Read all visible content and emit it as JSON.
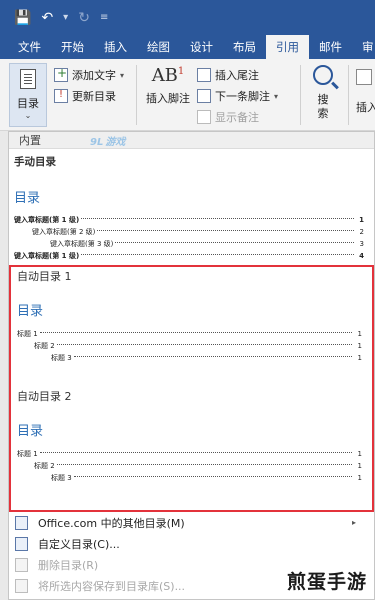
{
  "quick_access": {
    "icons": [
      "save-icon",
      "undo-icon",
      "redo-icon",
      "customize-icon"
    ]
  },
  "tabs": [
    "文件",
    "开始",
    "插入",
    "绘图",
    "设计",
    "布局",
    "引用",
    "邮件",
    "审"
  ],
  "active_tab": "引用",
  "ribbon": {
    "toc_label": "目录",
    "add_text": "添加文字",
    "update_toc": "更新目录",
    "insert_footnote": "插入脚注",
    "ab_glyph": "AB",
    "ab_sup": "1",
    "insert_endnote": "插入尾注",
    "next_footnote": "下一条脚注",
    "show_notes": "显示备注",
    "search_label": "搜\n索",
    "insert_partial": "插入"
  },
  "panel": {
    "header": "内置",
    "manual": {
      "title": "手动目录",
      "heading": "目录",
      "lines": [
        {
          "text": "键入章标题(第 1 级)",
          "page": "1",
          "level": 1
        },
        {
          "text": "键入章标题(第 2 级)",
          "page": "2",
          "level": 2
        },
        {
          "text": "键入章标题(第 3 级)",
          "page": "3",
          "level": 3
        },
        {
          "text": "键入章标题(第 1 级)",
          "page": "4",
          "level": 1
        }
      ]
    },
    "auto1": {
      "title": "自动目录 1",
      "heading": "目录",
      "lines": [
        {
          "text": "标题 1",
          "page": "1",
          "level": 1
        },
        {
          "text": "标题 2",
          "page": "1",
          "level": 2
        },
        {
          "text": "标题 3",
          "page": "1",
          "level": 3
        }
      ]
    },
    "auto2": {
      "title": "自动目录 2",
      "heading": "目录",
      "lines": [
        {
          "text": "标题 1",
          "page": "1",
          "level": 1
        },
        {
          "text": "标题 2",
          "page": "1",
          "level": 2
        },
        {
          "text": "标题 3",
          "page": "1",
          "level": 3
        }
      ]
    },
    "menu": [
      {
        "label": "Office.com 中的其他目录(M)",
        "has_arrow": true,
        "disabled": false
      },
      {
        "label": "自定义目录(C)...",
        "has_arrow": false,
        "disabled": false
      },
      {
        "label": "删除目录(R)",
        "has_arrow": false,
        "disabled": true
      },
      {
        "label": "将所选内容保存到目录库(S)...",
        "has_arrow": false,
        "disabled": true
      }
    ]
  },
  "watermarks": {
    "logo": "9L",
    "logo_sub": "游戏",
    "bottom": "煎蛋手游"
  },
  "colors": {
    "ribbon_blue": "#2b579a",
    "heading_blue": "#2e6fb5",
    "highlight_red": "#e3323b"
  }
}
